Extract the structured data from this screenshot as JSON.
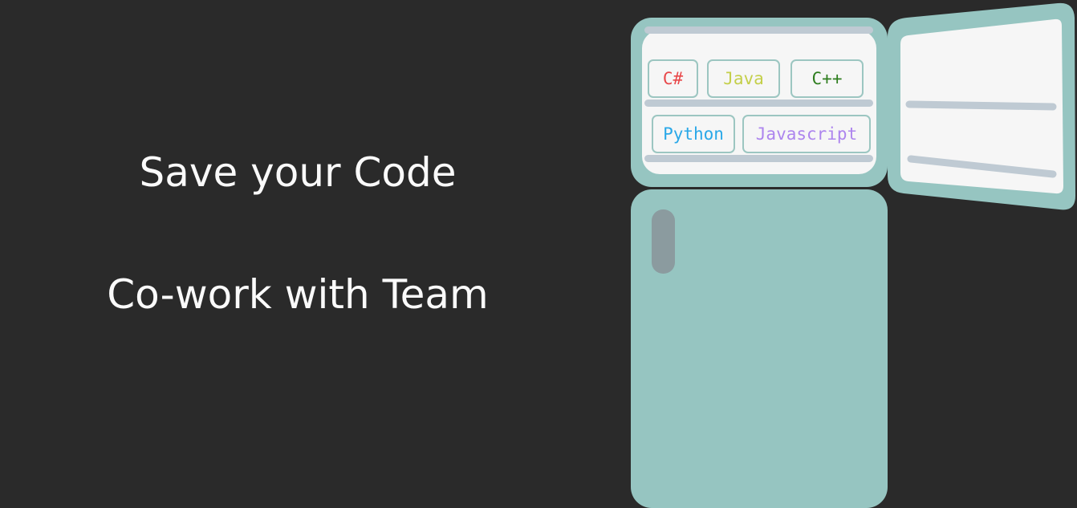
{
  "headlines": {
    "line1": "Save your Code",
    "line2": "Co-work with Team"
  },
  "fridge": {
    "colors": {
      "body": "#96c5c1",
      "interior": "#f6f6f6",
      "shelf": "#bfcad3",
      "handle": "#8b9b9f"
    },
    "languages": [
      {
        "label": "C#",
        "color": "#e8484a"
      },
      {
        "label": "Java",
        "color": "#c4cf4a"
      },
      {
        "label": "C++",
        "color": "#2e7d1e"
      },
      {
        "label": "Python",
        "color": "#2aa8e8"
      },
      {
        "label": "Javascript",
        "color": "#ad85ee"
      }
    ]
  }
}
